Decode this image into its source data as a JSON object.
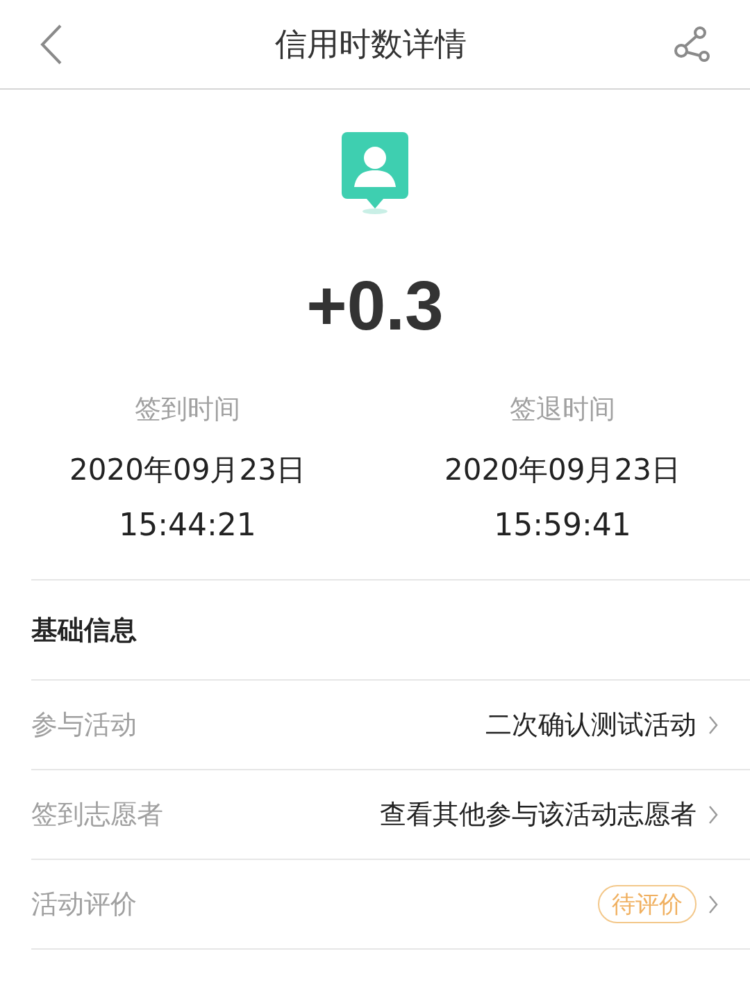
{
  "header": {
    "title": "信用时数详情"
  },
  "amount": "+0.3",
  "times": [
    {
      "label": "签到时间",
      "date": "2020年09月23日",
      "time": "15:44:21"
    },
    {
      "label": "签退时间",
      "date": "2020年09月23日",
      "time": "15:59:41"
    }
  ],
  "section_title": "基础信息",
  "rows": [
    {
      "label": "参与活动",
      "kind": "text",
      "value": "二次确认测试活动"
    },
    {
      "label": "签到志愿者",
      "kind": "text",
      "value": "查看其他参与该活动志愿者"
    },
    {
      "label": "活动评价",
      "kind": "badge",
      "value": "待评价"
    }
  ]
}
